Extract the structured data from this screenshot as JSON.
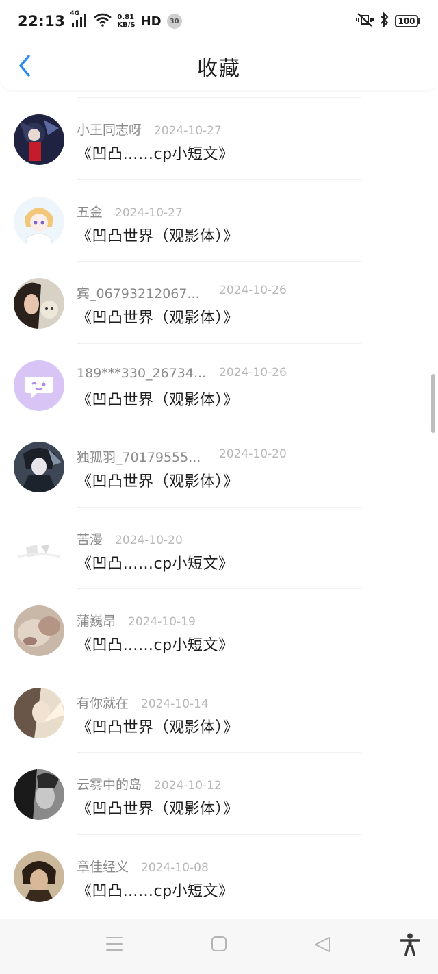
{
  "status_bar": {
    "time": "22:13",
    "network": "4G",
    "speed_value": "0.81",
    "speed_unit": "KB/S",
    "hd": "HD",
    "notification_count": "30",
    "battery": "100"
  },
  "header": {
    "title": "收藏"
  },
  "items": [
    {
      "name": "小王同志呀",
      "date": "2024-10-27",
      "title": "《凹凸……cp小短文》",
      "avatar": "avatar-dark-hero"
    },
    {
      "name": "五金",
      "date": "2024-10-27",
      "title": "《凹凸世界（观影体）》",
      "avatar": "avatar-blonde-anime"
    },
    {
      "name": "宾_06793212067...",
      "date": "2024-10-26",
      "title": "《凹凸世界（观影体）》",
      "avatar": "avatar-girl-plush"
    },
    {
      "name": "189***330_26734...",
      "date": "2024-10-26",
      "title": "《凹凸世界（观影体）》",
      "avatar": "avatar-purple-chat"
    },
    {
      "name": "独孤羽_70179555...",
      "date": "2024-10-20",
      "title": "《凹凸世界（观影体）》",
      "avatar": "avatar-dark-knight"
    },
    {
      "name": "苦漫",
      "date": "2024-10-20",
      "title": "《凹凸……cp小短文》",
      "avatar": "avatar-white-faded"
    },
    {
      "name": "蒲巍昂",
      "date": "2024-10-19",
      "title": "《凹凸……cp小短文》",
      "avatar": "avatar-blur-pink"
    },
    {
      "name": "有你就在",
      "date": "2024-10-14",
      "title": "《凹凸世界（观影体）》",
      "avatar": "avatar-light-girl"
    },
    {
      "name": "云雾中的岛",
      "date": "2024-10-12",
      "title": "《凹凸世界（观影体）》",
      "avatar": "avatar-grey-portrait"
    },
    {
      "name": "章佳经义",
      "date": "2024-10-08",
      "title": "《凹凸……cp小短文》",
      "avatar": "avatar-man-portrait"
    }
  ],
  "nav_bar": {
    "menu_icon": "menu-icon",
    "home_icon": "home-square-icon",
    "back_icon": "back-triangle-icon",
    "accessibility_icon": "accessibility-icon"
  },
  "colors": {
    "accent": "#2a8cf0",
    "name_text": "#8a8a8a",
    "date_text": "#b8b8b8",
    "title_text": "#1e1e1e"
  }
}
